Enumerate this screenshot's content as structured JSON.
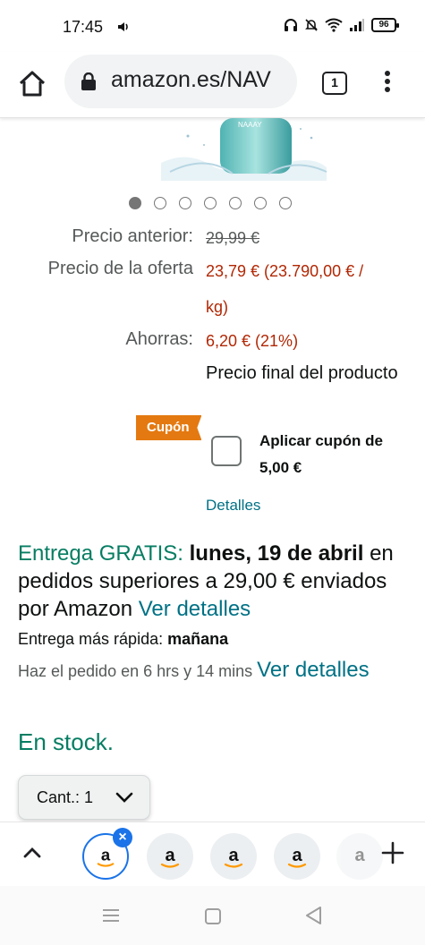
{
  "status_bar": {
    "time": "17:45",
    "battery": "96",
    "icons": [
      "volume-icon",
      "headphones-icon",
      "mute-bell-icon",
      "wifi-icon",
      "signal-icon",
      "battery-icon"
    ]
  },
  "browser": {
    "url": "amazon.es/NAV",
    "tab_count": "1"
  },
  "carousel": {
    "total": 7,
    "active_index": 0
  },
  "pricing": {
    "previous_label": "Precio anterior:",
    "previous_value": "29,99 €",
    "offer_label": "Precio de la oferta",
    "offer_value_line1": "23,79 € (23.790,00 € /",
    "offer_value_line2": "kg)",
    "savings_label": "Ahorras:",
    "savings_value": "6,20 € (21%)",
    "final_price_note": "Precio final del producto"
  },
  "coupon": {
    "badge": "Cupón",
    "apply_text": "Aplicar cupón de 5,00 €",
    "checked": false,
    "details_link": "Detalles"
  },
  "delivery": {
    "free_label": "Entrega GRATIS:",
    "date": "lunes, 19 de abril",
    "condition": "en pedidos superiores a 29,00 € enviados por Amazon",
    "details_link": "Ver detalles",
    "fast_label": "Entrega más rápida:",
    "fast_date": "mañana",
    "order_within": "Haz el pedido en 6 hrs y 14 mins",
    "order_details_link": "Ver detalles"
  },
  "stock": "En stock.",
  "quantity": {
    "label": "Cant.:",
    "value": "1"
  },
  "tab_strip": {
    "tab_icon_letter": "a",
    "close_symbol": "×"
  },
  "colors": {
    "accent_teal": "#007185",
    "price_red": "#b12704",
    "stock_green": "#067d62",
    "coupon_orange": "#e47911",
    "active_tab_blue": "#1a73e8"
  }
}
